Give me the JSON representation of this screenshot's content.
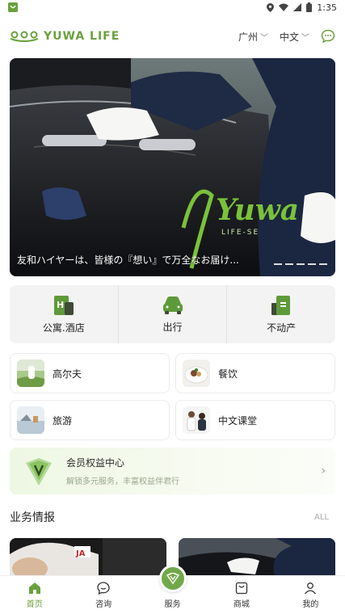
{
  "status_bar": {
    "time": "1:35"
  },
  "header": {
    "logo_text": "YUWA LIFE",
    "city": "广州",
    "language": "中文"
  },
  "banner": {
    "caption": "友和ハイヤーは、皆様の『想い』で万全なお届け...",
    "brand_text": "Yuwa",
    "brand_sub": "LIFE-SE"
  },
  "categories": [
    {
      "label": "公寓.酒店",
      "icon": "hotel-icon"
    },
    {
      "label": "出行",
      "icon": "car-icon"
    },
    {
      "label": "不动产",
      "icon": "building-icon"
    }
  ],
  "services": [
    {
      "label": "高尔夫",
      "icon": "golf-thumb"
    },
    {
      "label": "餐饮",
      "icon": "dining-thumb"
    },
    {
      "label": "旅游",
      "icon": "travel-thumb"
    },
    {
      "label": "中文课堂",
      "icon": "chinese-class-thumb"
    }
  ],
  "member": {
    "title": "会员权益中心",
    "subtitle": "解锁多元服务，丰富权益伴君行"
  },
  "news": {
    "title": "业务情报",
    "all_label": "ALL"
  },
  "bottom_nav": {
    "items": [
      {
        "label": "首页",
        "icon": "home-icon"
      },
      {
        "label": "咨询",
        "icon": "chat-icon"
      },
      {
        "label": "服务",
        "icon": "service-icon"
      },
      {
        "label": "商城",
        "icon": "shop-icon"
      },
      {
        "label": "我的",
        "icon": "profile-icon"
      }
    ]
  },
  "colors": {
    "accent": "#6aa13d",
    "banner_logo": "#7ac23a"
  }
}
